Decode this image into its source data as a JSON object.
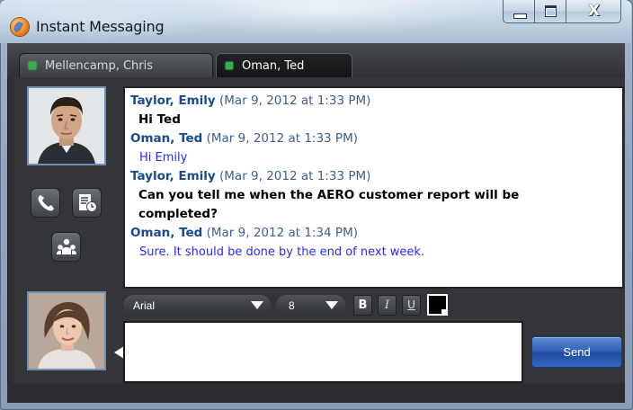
{
  "window": {
    "title": "Instant Messaging",
    "minimize_icon": "minimize-icon",
    "maximize_icon": "maximize-icon",
    "close_icon": "close-icon",
    "close_glyph": "X"
  },
  "tabs": [
    {
      "label": "Mellencamp, Chris",
      "status": "online",
      "active": false
    },
    {
      "label": "Oman, Ted",
      "status": "online",
      "active": true
    }
  ],
  "transcript": [
    {
      "sender": "Taylor, Emily",
      "timestamp": "(Mar 9, 2012 at 1:33 PM)",
      "lines": [
        "Hi Ted"
      ],
      "mine": true
    },
    {
      "sender": "Oman, Ted",
      "timestamp": "(Mar 9, 2012 at 1:33 PM)",
      "lines": [
        "Hi Emily"
      ],
      "mine": false
    },
    {
      "sender": "Taylor, Emily",
      "timestamp": "(Mar 9, 2012 at 1:33 PM)",
      "lines": [
        "Can you tell me when the AERO customer report will be",
        "completed?"
      ],
      "mine": true
    },
    {
      "sender": "Oman, Ted",
      "timestamp": "(Mar 9, 2012 at 1:34 PM)",
      "lines": [
        "Sure. It should be done by the end of next week."
      ],
      "mine": false
    }
  ],
  "actions": {
    "call_icon": "phone-icon",
    "notes_icon": "notes-icon",
    "group_icon": "group-icon"
  },
  "toolbar": {
    "font": "Arial",
    "size": "8",
    "bold_label": "B",
    "italic_label": "I",
    "underline_label": "U",
    "text_color": "#000000"
  },
  "compose": {
    "value": "",
    "send_label": "Send"
  },
  "colors": {
    "status_online": "#32b34a",
    "sender_name": "#1a4a8e",
    "incoming_text": "#2a2aff",
    "send_button": "#2f5fb7"
  }
}
